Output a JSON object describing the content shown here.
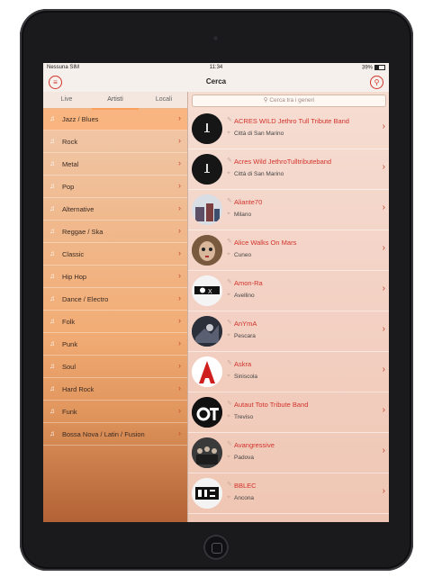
{
  "status": {
    "carrier": "Nessuna SIM",
    "time": "11:34",
    "battery": "39%"
  },
  "nav": {
    "title": "Cerca",
    "menu_icon": "menu-icon",
    "search_icon": "search-icon"
  },
  "tabs": [
    {
      "label": "Live"
    },
    {
      "label": "Artisti"
    },
    {
      "label": "Locali"
    }
  ],
  "genres": [
    {
      "label": "Jazz / Blues"
    },
    {
      "label": "Rock"
    },
    {
      "label": "Metal"
    },
    {
      "label": "Pop"
    },
    {
      "label": "Alternative"
    },
    {
      "label": "Reggae / Ska"
    },
    {
      "label": "Classic"
    },
    {
      "label": "Hip Hop"
    },
    {
      "label": "Dance / Electro"
    },
    {
      "label": "Folk"
    },
    {
      "label": "Punk"
    },
    {
      "label": "Soul"
    },
    {
      "label": "Hard Rock"
    },
    {
      "label": "Funk"
    },
    {
      "label": "Bossa Nova / Latin / Fusion"
    }
  ],
  "search": {
    "placeholder": "Cerca tra i generi"
  },
  "artists": [
    {
      "name": "ACRES WILD Jethro Tull Tribute Band",
      "city": "Città di San Marino"
    },
    {
      "name": "Acres Wild JethroTulltributeband",
      "city": "Città di San Marino"
    },
    {
      "name": "Aliante70",
      "city": "Milano"
    },
    {
      "name": "Alice Walks On Mars",
      "city": "Cuneo"
    },
    {
      "name": "Amon-Ra",
      "city": "Avellino"
    },
    {
      "name": "AnYmA",
      "city": "Pescara"
    },
    {
      "name": "Askra",
      "city": "Siniscola"
    },
    {
      "name": "Autaut Toto Tribute Band",
      "city": "Treviso"
    },
    {
      "name": "Avangressive",
      "city": "Padova"
    },
    {
      "name": "BBLEC",
      "city": "Ancona"
    }
  ],
  "colors": {
    "accent": "#d2332c",
    "panel": "#f0b98d"
  }
}
